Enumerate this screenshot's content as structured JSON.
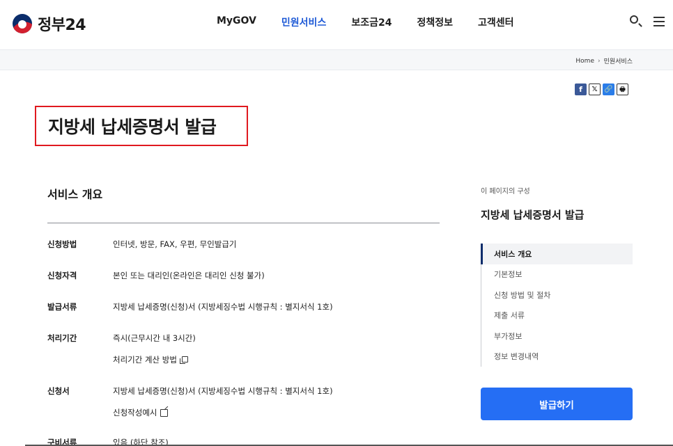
{
  "header": {
    "logo_text": "정부24",
    "nav": [
      "MyGOV",
      "민원서비스",
      "보조금24",
      "정책정보",
      "고객센터"
    ],
    "active_nav": "민원서비스",
    "search_icon": "search-icon",
    "menu_icon": "hamburger-menu-icon"
  },
  "breadcrumb": {
    "home": "Home",
    "separator": "›",
    "current": "민원서비스"
  },
  "share": {
    "facebook": "f",
    "x": "𝕏",
    "link": "🔗",
    "print": "🖶"
  },
  "page_title": "지방세 납세증명서 발급",
  "overview": {
    "section_title": "서비스 개요",
    "rows": [
      {
        "label": "신청방법",
        "value": "인터넷, 방문, FAX, 우편, 무인발급기"
      },
      {
        "label": "신청자격",
        "value": "본인 또는 대리인(온라인은 대리인 신청 불가)"
      },
      {
        "label": "발급서류",
        "value": "지방세 납세증명(신청)서 (지방세징수법 시행규칙 : 별지서식 1호)"
      },
      {
        "label": "처리기간",
        "value": "즉시(근무시간 내 3시간)",
        "link": "처리기간 계산 방법"
      },
      {
        "label": "신청서",
        "value": "지방세 납세증명(신청)서 (지방세징수법 시행규칙 : 별지서식 1호)",
        "link": "신청작성예시"
      },
      {
        "label": "구비서류",
        "value": "있음 (하단 참조)"
      }
    ]
  },
  "sidebar": {
    "caption": "이 페이지의 구성",
    "title": "지방세 납세증명서 발급",
    "items": [
      "서비스 개요",
      "기본정보",
      "신청 방법 및 절차",
      "제출 서류",
      "부가정보",
      "정보 변경내역"
    ],
    "active_item": "서비스 개요",
    "issue_button": "발급하기"
  },
  "colors": {
    "accent": "#256ef4",
    "active_nav": "#1d59d6",
    "highlight_border": "#e0191f"
  }
}
